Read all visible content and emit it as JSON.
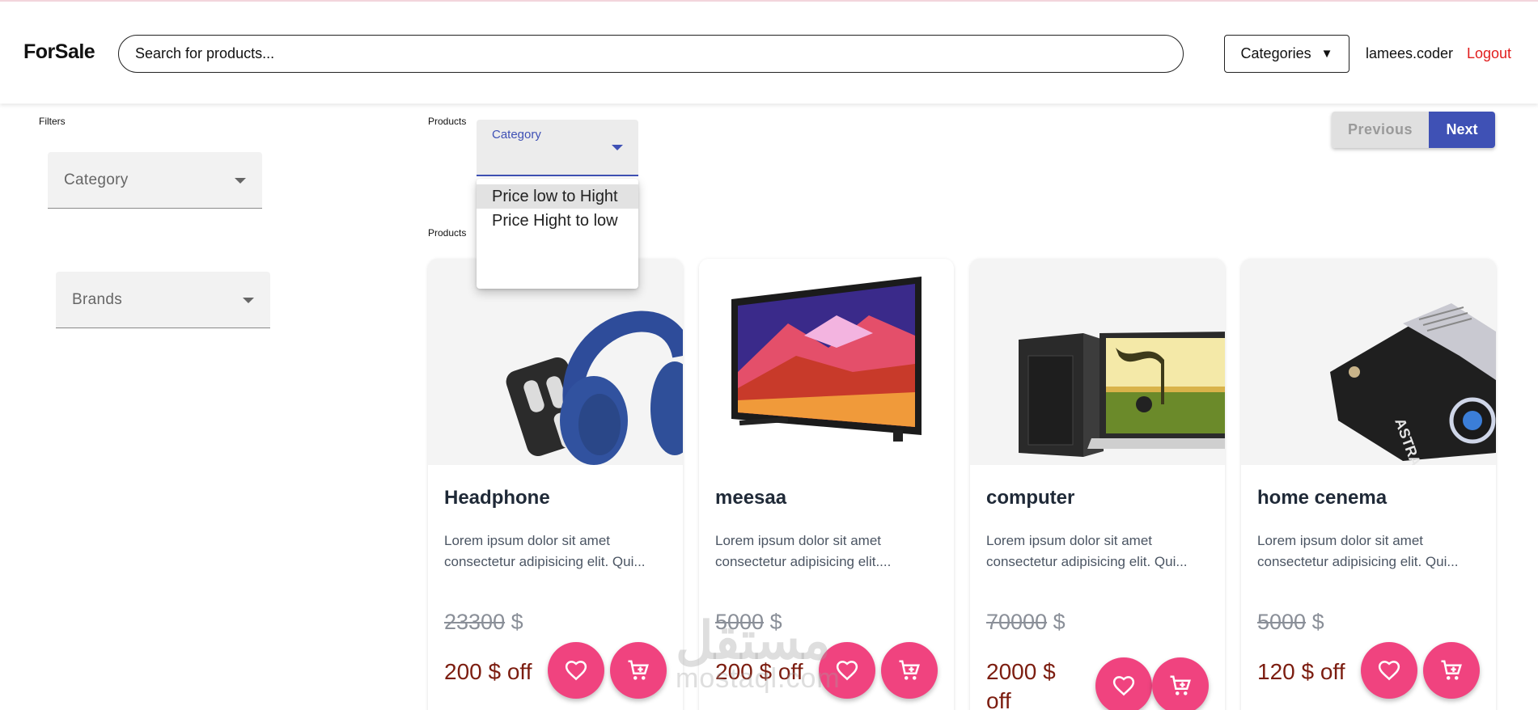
{
  "header": {
    "brand": "ForSale",
    "search_placeholder": "Search for products...",
    "categories_label": "Categories",
    "categories_caret": "▼",
    "username": "lamees.coder",
    "logout_label": "Logout"
  },
  "filters": {
    "title": "Filters",
    "category_label": "Category",
    "brands_label": "Brands"
  },
  "products_section": {
    "label_top": "Products",
    "label_bottom": "Products",
    "sort": {
      "label": "Category",
      "options": [
        "Price low to Hight",
        "Price Hight to low"
      ],
      "highlighted_option": "Price low to Hight"
    },
    "pagination": {
      "previous_label": "Previous",
      "next_label": "Next"
    }
  },
  "products": [
    {
      "title": "Headphone",
      "desc_line1": "Lorem ipsum dolor sit amet",
      "desc_line2": "consectetur adipisicing elit. Qui...",
      "old_price": "23300",
      "currency": "$",
      "discount": "200 $ off",
      "image_icon": "headphones-image"
    },
    {
      "title": "meesaa",
      "desc_line1": "Lorem ipsum dolor sit amet",
      "desc_line2": "consectetur adipisicing elit....",
      "old_price": "5000",
      "currency": "$",
      "discount": "200 $ off",
      "image_icon": "tv-image"
    },
    {
      "title": "computer",
      "desc_line1": "Lorem ipsum dolor sit amet",
      "desc_line2": "consectetur adipisicing elit. Qui...",
      "old_price": "70000",
      "currency": "$",
      "discount": "2000 $ off",
      "image_icon": "computer-image"
    },
    {
      "title": "home cenema",
      "desc_line1": "Lorem ipsum dolor sit amet",
      "desc_line2": "consectetur adipisicing elit. Qui...",
      "old_price": "5000",
      "currency": "$",
      "discount": "120 $ off",
      "image_icon": "projector-image"
    }
  ],
  "watermark": {
    "arabic": "مستقل",
    "latin": "mostaql.com"
  },
  "colors": {
    "accent": "#3f51b5",
    "fab": "#f0437f",
    "logout": "#e11d1d",
    "discount": "#7c1d10"
  }
}
